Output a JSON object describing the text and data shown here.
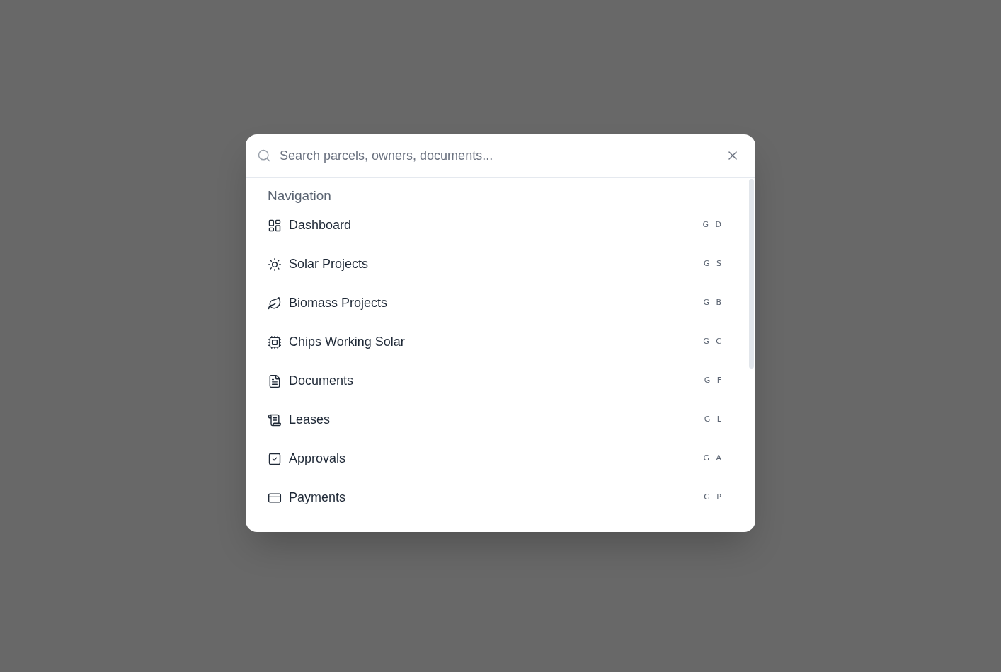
{
  "search": {
    "placeholder": "Search parcels, owners, documents..."
  },
  "section": {
    "title": "Navigation"
  },
  "items": [
    {
      "label": "Dashboard",
      "shortcut": "G D"
    },
    {
      "label": "Solar Projects",
      "shortcut": "G S"
    },
    {
      "label": "Biomass Projects",
      "shortcut": "G B"
    },
    {
      "label": "Chips Working Solar",
      "shortcut": "G C"
    },
    {
      "label": "Documents",
      "shortcut": "G F"
    },
    {
      "label": "Leases",
      "shortcut": "G L"
    },
    {
      "label": "Approvals",
      "shortcut": "G A"
    },
    {
      "label": "Payments",
      "shortcut": "G P"
    }
  ]
}
